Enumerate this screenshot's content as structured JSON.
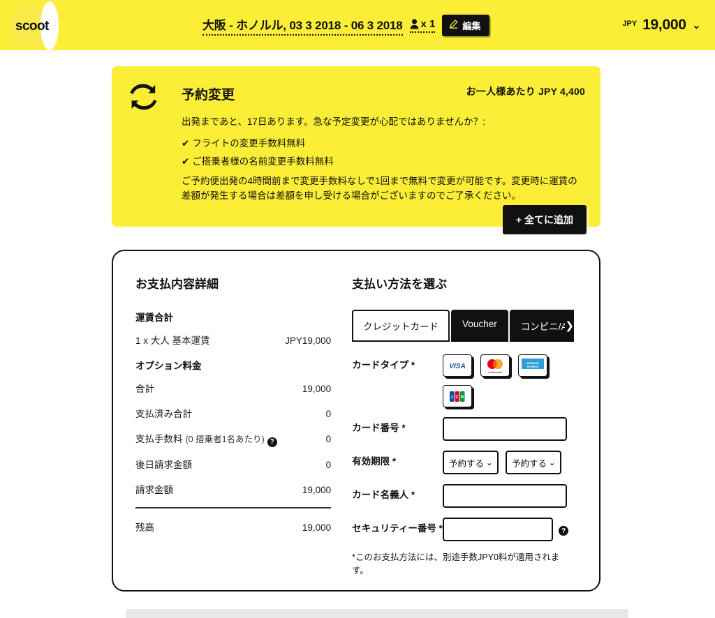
{
  "brand": {
    "logo_text": "scoot",
    "accent": "#FCEE36",
    "ink": "#111111"
  },
  "header": {
    "trip": "大阪 - ホノルル, 03 3 2018 - 06 3 2018",
    "pax_count": "x 1",
    "pax_icon": "person-icon",
    "edit_label": "編集",
    "edit_icon": "pencil-icon",
    "currency_code": "JPY",
    "currency_amount": "19,000",
    "chevron": "⌄"
  },
  "promo": {
    "icon": "exchange-arrows-icon",
    "title": "予約変更",
    "price": "お一人様あたり JPY 4,400",
    "lead": "出発まであと、17日あります。急な予定変更が心配ではありませんか？:",
    "benefits": [
      {
        "tick": "✔",
        "text": "フライトの変更手数料無料"
      },
      {
        "tick": "✔",
        "text": "ご搭乗者様の名前変更手数料無料"
      }
    ],
    "note": "ご予約便出発の4時間前まで変更手数料なしで1回まで無料で変更が可能です。変更時に運賃の差額が発生する場合は差額を申し受ける場合がございますのでご了承ください。",
    "add_all_label": "+ 全てに追加"
  },
  "summary": {
    "title": "お支払内容詳細",
    "fare_heading": "運賃合計",
    "fare_row": {
      "label": "1 x 大人 基本運賃",
      "value": "JPY19,000"
    },
    "options_heading": "オプション料金",
    "rows": [
      {
        "label": "合計",
        "sub": "",
        "value": "19,000",
        "help": false
      },
      {
        "label": "支払済み合計",
        "sub": "",
        "value": "0",
        "help": false
      },
      {
        "label": "支払手数料",
        "sub": "(0 搭乗者1名あたり)",
        "value": "0",
        "help": true,
        "help_icon": "question-mark-icon"
      },
      {
        "label": "後日請求金額",
        "sub": "",
        "value": "0",
        "help": false
      },
      {
        "label": "請求金額",
        "sub": "",
        "value": "19,000",
        "help": false
      }
    ],
    "balance": {
      "label": "残高",
      "value": "19,000"
    }
  },
  "payment": {
    "title": "支払い方法を選ぶ",
    "tabs": [
      {
        "label": "クレジットカード",
        "active": true
      },
      {
        "label": "Voucher",
        "active": false
      },
      {
        "label": "コンビニ/A",
        "active": false
      }
    ],
    "tabs_overflow_arrow": "❯",
    "fields": {
      "card_type_label": "カードタイプ *",
      "card_brands": [
        {
          "name": "visa-card-icon",
          "label": "VISA"
        },
        {
          "name": "mastercard-card-icon",
          "label": "mastercard"
        },
        {
          "name": "amex-card-icon",
          "label": "AMERICAN EXPRESS"
        },
        {
          "name": "jcb-card-icon",
          "label": "JCB"
        }
      ],
      "card_number_label": "カード番号 *",
      "card_number_value": "",
      "card_number_placeholder": "",
      "expiry_label": "有効期限 *",
      "expiry_month": "予約する",
      "expiry_year": "予約する",
      "card_name_label": "カード名義人 *",
      "card_name_value": "",
      "card_name_placeholder": "",
      "cvv_label": "セキュリティー番号 *",
      "cvv_value": "",
      "cvv_placeholder": "",
      "cvv_help_icon": "question-mark-icon"
    },
    "fee_note": "*このお支払方法には、別途手数JPY0料が適用されます。"
  }
}
